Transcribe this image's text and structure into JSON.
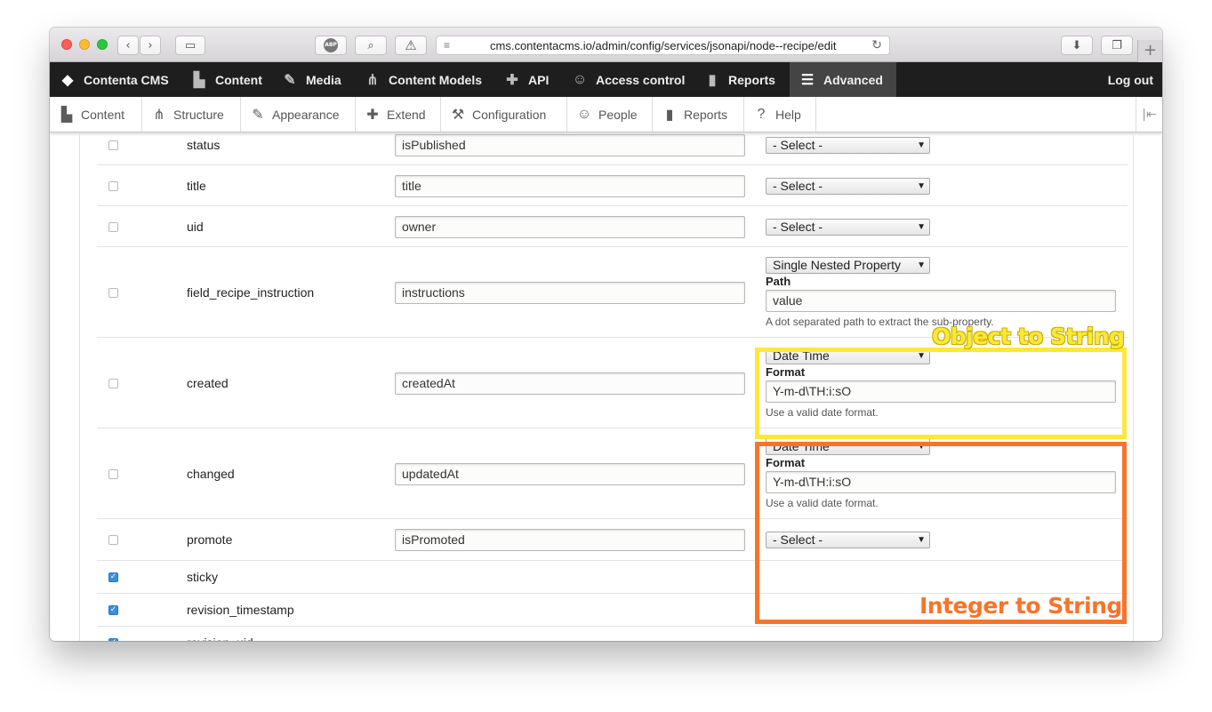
{
  "browser": {
    "url": "cms.contentacms.io/admin/config/services/jsonapi/node--recipe/edit",
    "icons": [
      "back-icon",
      "forward-icon",
      "sidebar-icon",
      "adblock-icon",
      "search-icon",
      "warning-icon",
      "reader-icon",
      "reload-icon",
      "download-icon",
      "tabs-icon",
      "new-tab-icon"
    ],
    "abp_label": "ABP"
  },
  "toolbar": {
    "items": [
      {
        "label": "Contenta CMS",
        "icon": "contenta-logo-icon"
      },
      {
        "label": "Content",
        "icon": "document-icon"
      },
      {
        "label": "Media",
        "icon": "wrench-icon"
      },
      {
        "label": "Content Models",
        "icon": "structure-icon"
      },
      {
        "label": "API",
        "icon": "puzzle-icon"
      },
      {
        "label": "Access control",
        "icon": "people-icon"
      },
      {
        "label": "Reports",
        "icon": "bar-chart-icon"
      },
      {
        "label": "Advanced",
        "icon": "menu-icon"
      }
    ],
    "logout": "Log out"
  },
  "tray": {
    "items": [
      {
        "label": "Content",
        "icon": "document-icon"
      },
      {
        "label": "Structure",
        "icon": "structure-icon"
      },
      {
        "label": "Appearance",
        "icon": "brush-icon"
      },
      {
        "label": "Extend",
        "icon": "puzzle-icon"
      },
      {
        "label": "Configuration",
        "icon": "wrench-icon"
      },
      {
        "label": "People",
        "icon": "people-icon"
      },
      {
        "label": "Reports",
        "icon": "bar-chart-icon"
      },
      {
        "label": "Help",
        "icon": "help-icon"
      }
    ]
  },
  "fields": {
    "rows": [
      {
        "name": "status",
        "alias": "isPublished",
        "enhancer": "- Select -",
        "checked": false
      },
      {
        "name": "title",
        "alias": "title",
        "enhancer": "- Select -",
        "checked": false
      },
      {
        "name": "uid",
        "alias": "owner",
        "enhancer": "- Select -",
        "checked": false
      },
      {
        "name": "field_recipe_instruction",
        "alias": "instructions",
        "enhancer": "Single Nested Property",
        "setting_label": "Path",
        "setting_value": "value",
        "setting_desc": "A dot separated path to extract the sub-property.",
        "checked": false
      },
      {
        "name": "created",
        "alias": "createdAt",
        "enhancer": "Date Time",
        "setting_label": "Format",
        "setting_value": "Y-m-d\\TH:i:sO",
        "setting_desc": "Use a valid date format.",
        "checked": false
      },
      {
        "name": "changed",
        "alias": "updatedAt",
        "enhancer": "Date Time",
        "setting_label": "Format",
        "setting_value": "Y-m-d\\TH:i:sO",
        "setting_desc": "Use a valid date format.",
        "checked": false
      },
      {
        "name": "promote",
        "alias": "isPromoted",
        "enhancer": "- Select -",
        "checked": false
      },
      {
        "name": "sticky",
        "checked": true
      },
      {
        "name": "revision_timestamp",
        "checked": true
      },
      {
        "name": "revision_uid",
        "checked": true
      }
    ]
  },
  "annotations": {
    "object_to_string": "Object to String",
    "integer_to_string": "Integer to String",
    "yellow": "#fde83a",
    "orange": "#f7742a"
  }
}
